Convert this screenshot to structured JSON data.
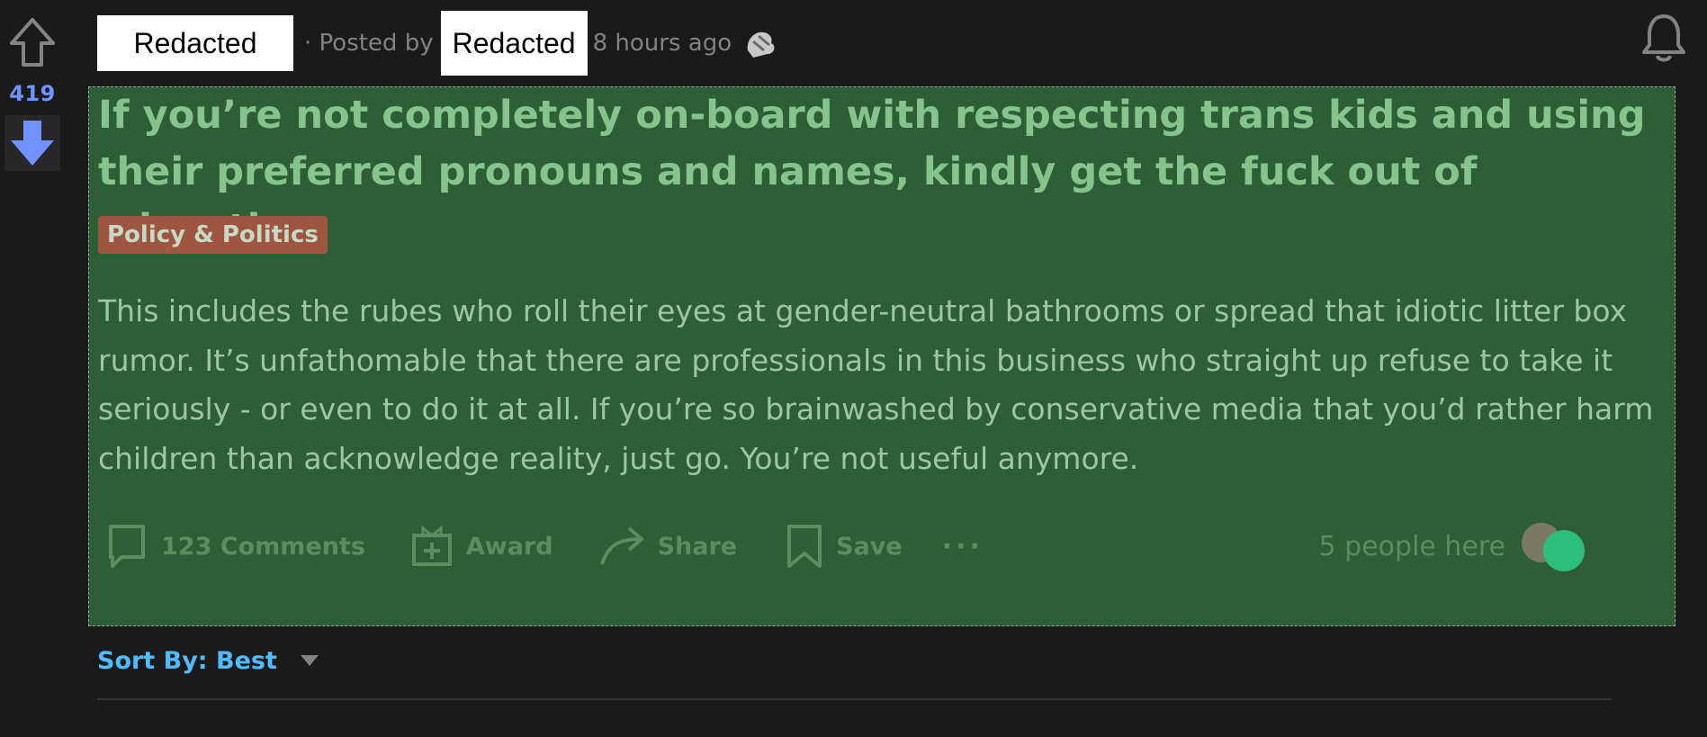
{
  "vote": {
    "score": "419",
    "upvote_icon": "arrow-up-outline-icon",
    "downvote_icon": "arrow-down-filled-icon"
  },
  "header": {
    "redacted_1": "Redacted",
    "separator": "· Posted by",
    "redacted_2": "Redacted",
    "time": "8 hours ago",
    "award_icon": "award-badge-icon",
    "bell_icon": "bell-icon"
  },
  "post": {
    "title": "If you’re not completely on-board with respecting trans kids and using their preferred pronouns and names, kindly get the fuck out of education.",
    "flair": "Policy & Politics",
    "body": "This includes the rubes who roll their eyes at gender-neutral bathrooms or spread that idiotic litter box rumor. It’s unfathomable that there are professionals in this business who straight up refuse to take it seriously - or even to do it at all. If you’re so brainwashed by conservative media that you’d rather harm children than acknowledge reality, just go. You’re not useful anymore."
  },
  "actions": {
    "comments": "123 Comments",
    "award": "Award",
    "share": "Share",
    "save": "Save",
    "more": "···",
    "people_here": "5 people here"
  },
  "sort": {
    "label": "Sort By: Best"
  },
  "colors": {
    "background": "#1a1a1b",
    "post_highlight": "#2e5e35",
    "title": "#85c58d",
    "flair_bg": "#9e5640",
    "score": "#7193ff",
    "sort_link": "#4fbcff"
  }
}
